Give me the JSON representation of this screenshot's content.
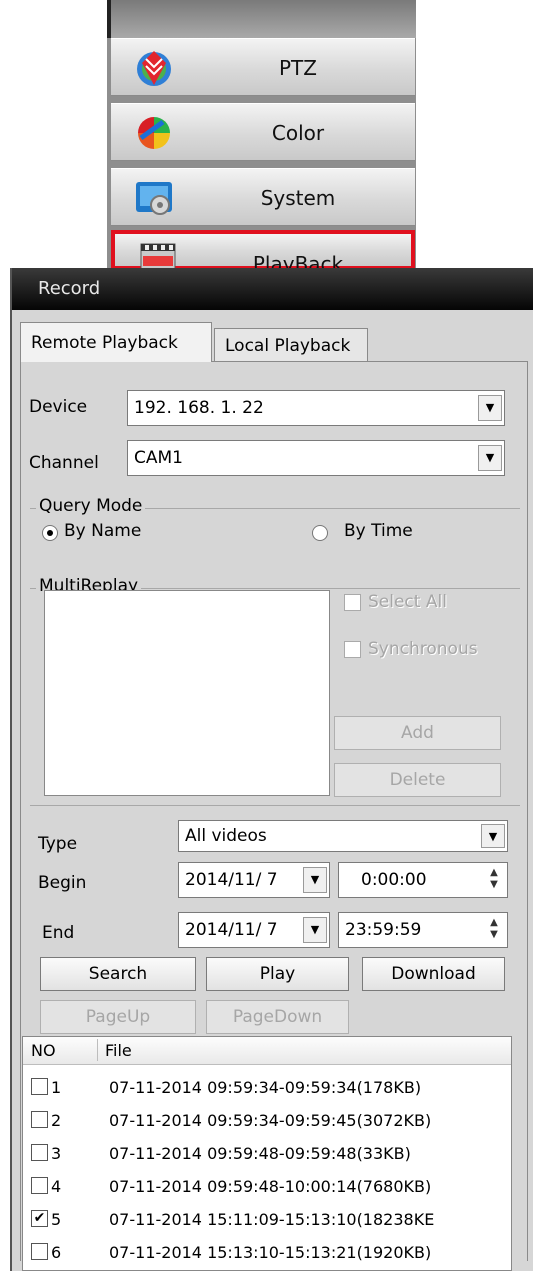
{
  "menu": {
    "items": [
      {
        "label": "PTZ",
        "icon": "ptz-icon"
      },
      {
        "label": "Color",
        "icon": "color-icon"
      },
      {
        "label": "System",
        "icon": "system-icon"
      },
      {
        "label": "PlayBack",
        "icon": "playback-icon",
        "active": true
      }
    ],
    "active_color": "#e0101e"
  },
  "panel": {
    "title": "Record",
    "tabs": [
      "Remote Playback",
      "Local Playback"
    ],
    "device": {
      "label": "Device",
      "value": "192. 168. 1. 22"
    },
    "channel": {
      "label": "Channel",
      "value": "CAM1"
    },
    "query_mode": {
      "title": "Query Mode",
      "options": [
        "By Name",
        "By Time"
      ],
      "selected": "By Name"
    },
    "multireplay": {
      "title": "MultiReplay",
      "select_all": "Select All",
      "synchronous": "Synchronous",
      "add": "Add",
      "delete": "Delete"
    },
    "type": {
      "label": "Type",
      "value": "All videos"
    },
    "begin": {
      "label": "Begin",
      "date": "2014/11/ 7",
      "time": "0:00:00"
    },
    "end": {
      "label": "End",
      "date": "2014/11/ 7",
      "time": "23:59:59"
    },
    "buttons": {
      "search": "Search",
      "play": "Play",
      "download": "Download",
      "pageup": "PageUp",
      "pagedown": "PageDown"
    },
    "table": {
      "headers": [
        "NO",
        "File"
      ],
      "rows": [
        {
          "no": "1",
          "file": "07-11-2014 09:59:34-09:59:34(178KB)",
          "checked": false
        },
        {
          "no": "2",
          "file": "07-11-2014 09:59:34-09:59:45(3072KB)",
          "checked": false
        },
        {
          "no": "3",
          "file": "07-11-2014 09:59:48-09:59:48(33KB)",
          "checked": false
        },
        {
          "no": "4",
          "file": "07-11-2014 09:59:48-10:00:14(7680KB)",
          "checked": false
        },
        {
          "no": "5",
          "file": "07-11-2014 15:11:09-15:13:10(18238KE",
          "checked": true
        },
        {
          "no": "6",
          "file": "07-11-2014 15:13:10-15:13:21(1920KB)",
          "checked": false
        }
      ]
    }
  }
}
